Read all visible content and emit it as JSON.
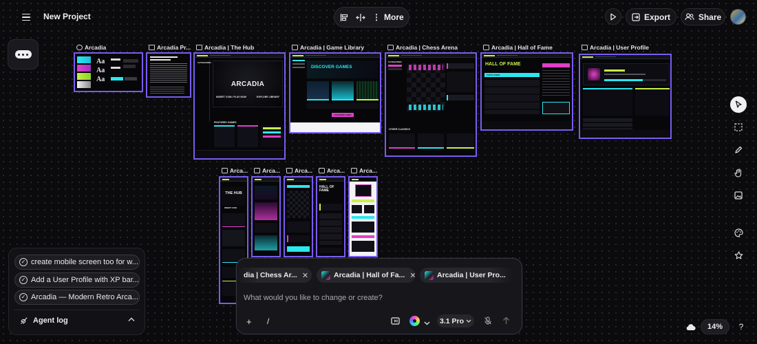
{
  "header": {
    "project_title": "New Project",
    "more_label": "More",
    "export_label": "Export",
    "share_label": "Share"
  },
  "canvas": {
    "desktop_frames": [
      {
        "label": "Arcadia",
        "icon": "palette-icon"
      },
      {
        "label": "Arcadia Pr...",
        "icon": "document-icon"
      },
      {
        "label": "Arcadia | The Hub",
        "icon": "monitor-icon",
        "screen_title": "ARCADIA",
        "cta_left": "INSERT COIN / PLAY NOW",
        "cta_right": "EXPLORE LIBRARY",
        "section": "FEATURED GAMES",
        "side_heading": "CATEGORIES"
      },
      {
        "label": "Arcadia | Game Library",
        "icon": "monitor-icon",
        "screen_title": "DISCOVER GAMES",
        "button": "LOAD MORE GAMES"
      },
      {
        "label": "Arcadia | Chess Arena",
        "icon": "monitor-icon",
        "section": "OTHER CLASSICS",
        "side_heading": "CATEGORIES"
      },
      {
        "label": "Arcadia | Hall of Fame",
        "icon": "monitor-icon",
        "screen_title": "HALL OF FAME",
        "section": "TOP PLAYERS"
      },
      {
        "label": "Arcadia | User Profile",
        "icon": "monitor-icon"
      }
    ],
    "mobile_frames": [
      {
        "label": "Arca...",
        "icon": "monitor-icon",
        "screen_title": "THE HUB",
        "sub": "INSERT COIN"
      },
      {
        "label": "Arca...",
        "icon": "monitor-icon"
      },
      {
        "label": "Arca...",
        "icon": "monitor-icon"
      },
      {
        "label": "Arca...",
        "icon": "monitor-icon",
        "screen_title": "HALL OF FAME"
      },
      {
        "label": "Arca...",
        "icon": "monitor-icon"
      }
    ]
  },
  "history": {
    "items": [
      "create mobile screen too for w...",
      "Add a User Profile with XP bar...",
      "Arcadia — Modern Retro Arca..."
    ],
    "agent_log_label": "Agent log"
  },
  "prompt": {
    "context_chips": [
      {
        "label": "dia | Chess Ar..."
      },
      {
        "label": "Arcadia | Hall of Fa..."
      },
      {
        "label": "Arcadia | User Pro..."
      }
    ],
    "placeholder": "What would you like to change or create?",
    "slash_label": "/",
    "model_label": "3.1 Pro"
  },
  "zoom": {
    "level": "14%"
  },
  "colors": {
    "frame_border": "#7a5cf0",
    "neon_cyan": "#2be6f0",
    "neon_magenta": "#e040c8",
    "neon_lime": "#c9f04a"
  }
}
